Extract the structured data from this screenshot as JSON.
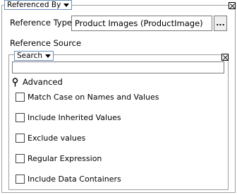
{
  "referenced_by": {
    "label": "Referenced By"
  },
  "reference_type": {
    "label": "Reference Type",
    "value": "Product Images (ProductImage)",
    "browse_label": "..."
  },
  "reference_source": {
    "label": "Reference Source"
  },
  "search": {
    "label": "Search",
    "value": "",
    "advanced_label": "Advanced",
    "options": [
      {
        "label": "Match Case on Names and Values",
        "checked": false
      },
      {
        "label": "Include Inherited Values",
        "checked": false
      },
      {
        "label": "Exclude values",
        "checked": false
      },
      {
        "label": "Regular Expression",
        "checked": false
      },
      {
        "label": "Include Data Containers",
        "checked": false
      }
    ]
  }
}
